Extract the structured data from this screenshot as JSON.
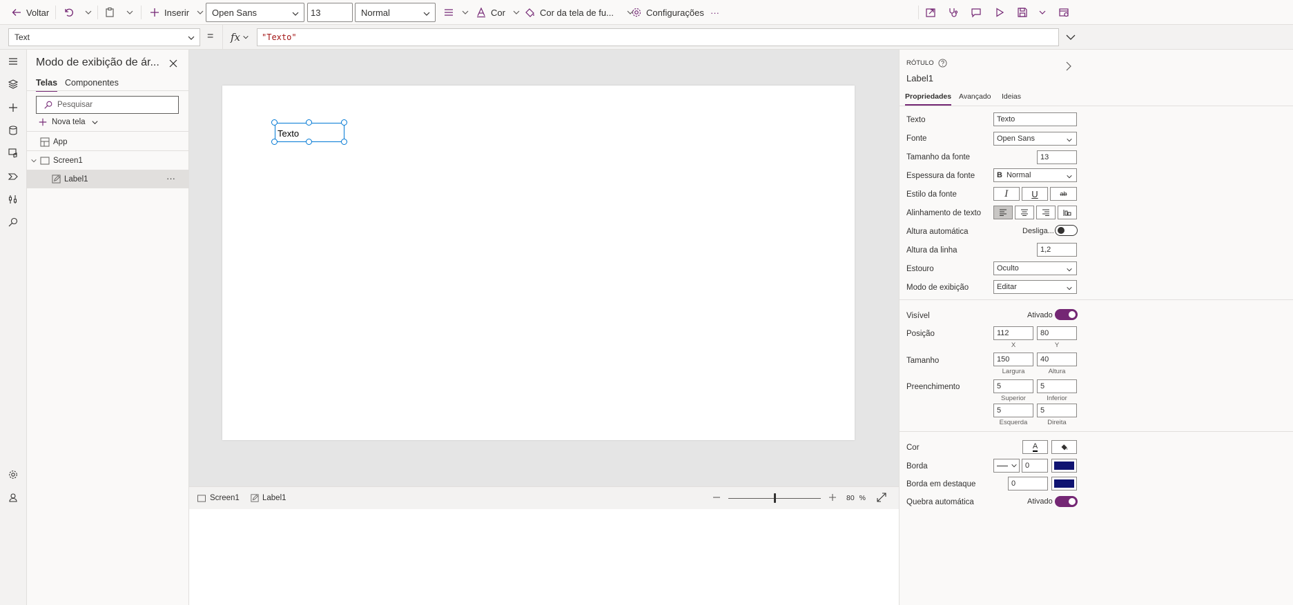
{
  "toolbar": {
    "back_label": "Voltar",
    "insert_label": "Inserir",
    "font_value": "Open Sans",
    "font_size_value": "13",
    "font_weight_value": "Normal",
    "color_label": "Cor",
    "fill_label": "Cor da tela de fu...",
    "settings_label": "Configurações",
    "more_label": "···"
  },
  "formula": {
    "property": "Text",
    "equals": "=",
    "fx": "fx",
    "value": "\"Texto\""
  },
  "tree": {
    "title": "Modo de exibição de ár...",
    "tabs": [
      {
        "label": "Telas",
        "active": true
      },
      {
        "label": "Componentes",
        "active": false
      }
    ],
    "search_placeholder": "Pesquisar",
    "new_screen_label": "Nova tela",
    "items": [
      {
        "label": "App"
      },
      {
        "label": "Screen1"
      },
      {
        "label": "Label1"
      }
    ],
    "more_label": "···"
  },
  "canvas": {
    "label_text": "Texto"
  },
  "statusbar": {
    "screen_label": "Screen1",
    "label_label": "Label1",
    "zoom_value": "80",
    "zoom_unit": "%",
    "zoom_level": 0.8
  },
  "props": {
    "type_label": "RÓTULO",
    "control_name": "Label1",
    "tabs": [
      {
        "label": "Propriedades",
        "active": true
      },
      {
        "label": "Avançado",
        "active": false
      },
      {
        "label": "Ideias",
        "active": false
      }
    ],
    "text_label": "Texto",
    "text_value": "Texto",
    "font_label": "Fonte",
    "font_value": "Open Sans",
    "font_size_label": "Tamanho da fonte",
    "font_size_value": "13",
    "font_weight_label": "Espessura da fonte",
    "font_weight_glyph": "B",
    "font_weight_value": "Normal",
    "font_style_label": "Estilo da fonte",
    "font_style_italic": "I",
    "font_style_underline": "U",
    "font_style_strike": "ab",
    "align_label": "Alinhamento de texto",
    "auto_height_label": "Altura automática",
    "auto_height_state": "Desliga...",
    "line_height_label": "Altura da linha",
    "line_height_value": "1,2",
    "overflow_label": "Estouro",
    "overflow_value": "Oculto",
    "display_mode_label": "Modo de exibição",
    "display_mode_value": "Editar",
    "visible_label": "Visível",
    "visible_state": "Ativado",
    "position_label": "Posição",
    "position_x": "112",
    "position_y": "80",
    "position_x_sub": "X",
    "position_y_sub": "Y",
    "size_label": "Tamanho",
    "size_w": "150",
    "size_h": "40",
    "size_w_sub": "Largura",
    "size_h_sub": "Altura",
    "padding_label": "Preenchimento",
    "pad_top": "5",
    "pad_bottom": "5",
    "pad_left": "5",
    "pad_right": "5",
    "pad_top_sub": "Superior",
    "pad_bottom_sub": "Inferior",
    "pad_left_sub": "Esquerda",
    "pad_right_sub": "Direita",
    "color_label": "Cor",
    "color_glyph": "A",
    "border_label": "Borda",
    "border_value": "0",
    "focus_border_label": "Borda em destaque",
    "focus_border_value": "0",
    "wrap_label": "Quebra automática",
    "wrap_state": "Ativado"
  },
  "colors": {
    "accent": "#742774",
    "selection": "#0078d4",
    "border_swatch": "#0f1371",
    "canvas_bg": "#e5e5e5"
  }
}
